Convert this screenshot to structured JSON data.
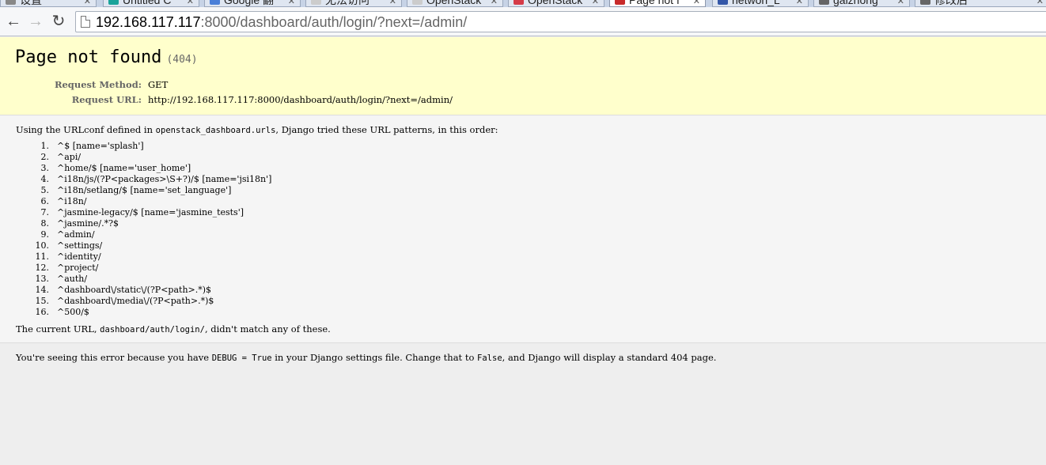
{
  "browser": {
    "tabs": [
      {
        "title": "设置",
        "favicon_color": "#888888",
        "active": false
      },
      {
        "title": "Untitled C",
        "favicon_color": "#1aa39a",
        "active": false
      },
      {
        "title": "Google 翻",
        "favicon_color": "#4a7fd8",
        "active": false
      },
      {
        "title": "无法访问",
        "favicon_color": "#cccccc",
        "active": false
      },
      {
        "title": "OpenStack",
        "favicon_color": "#cccccc",
        "active": false
      },
      {
        "title": "OpenStack",
        "favicon_color": "#d53b48",
        "active": false
      },
      {
        "title": "Page not f",
        "favicon_color": "#c82a2a",
        "active": true
      },
      {
        "title": "netwon_L",
        "favicon_color": "#3457a8",
        "active": false
      },
      {
        "title": "gaizhong",
        "favicon_color": "#666666",
        "active": false
      },
      {
        "title": "修改后",
        "favicon_color": "#666666",
        "active": false
      }
    ],
    "back_icon": "←",
    "forward_icon": "→",
    "reload_icon": "↻",
    "url_host": "192.168.117.117",
    "url_rest": ":8000/dashboard/auth/login/?next=/admin/"
  },
  "page": {
    "title": "Page not found",
    "status_code": "(404)",
    "request_method_label": "Request Method:",
    "request_method": "GET",
    "request_url_label": "Request URL:",
    "request_url": "http://192.168.117.117:8000/dashboard/auth/login/?next=/admin/",
    "urlconf_prefix": "Using the URLconf defined in ",
    "urlconf_module": "openstack_dashboard.urls",
    "urlconf_suffix": ", Django tried these URL patterns, in this order:",
    "patterns": [
      {
        "num": "1.",
        "pattern": "^$ [name='splash']"
      },
      {
        "num": "2.",
        "pattern": "^api/"
      },
      {
        "num": "3.",
        "pattern": "^home/$ [name='user_home']"
      },
      {
        "num": "4.",
        "pattern": "^i18n/js/(?P<packages>\\S+?)/$ [name='jsi18n']"
      },
      {
        "num": "5.",
        "pattern": "^i18n/setlang/$ [name='set_language']"
      },
      {
        "num": "6.",
        "pattern": "^i18n/"
      },
      {
        "num": "7.",
        "pattern": "^jasmine-legacy/$ [name='jasmine_tests']"
      },
      {
        "num": "8.",
        "pattern": "^jasmine/.*?$"
      },
      {
        "num": "9.",
        "pattern": "^admin/"
      },
      {
        "num": "10.",
        "pattern": "^settings/"
      },
      {
        "num": "11.",
        "pattern": "^identity/"
      },
      {
        "num": "12.",
        "pattern": "^project/"
      },
      {
        "num": "13.",
        "pattern": "^auth/"
      },
      {
        "num": "14.",
        "pattern": "^dashboard\\/static\\/(?P<path>.*)$"
      },
      {
        "num": "15.",
        "pattern": "^dashboard\\/media\\/(?P<path>.*)$"
      },
      {
        "num": "16.",
        "pattern": "^500/$"
      }
    ],
    "current_url_prefix": "The current URL, ",
    "current_url": "dashboard/auth/login/",
    "current_url_suffix": ", didn't match any of these.",
    "debug_prefix": "You're seeing this error because you have ",
    "debug_code": "DEBUG = True",
    "debug_mid": " in your Django settings file. Change that to ",
    "debug_false": "False",
    "debug_suffix": ", and Django will display a standard 404 page."
  }
}
